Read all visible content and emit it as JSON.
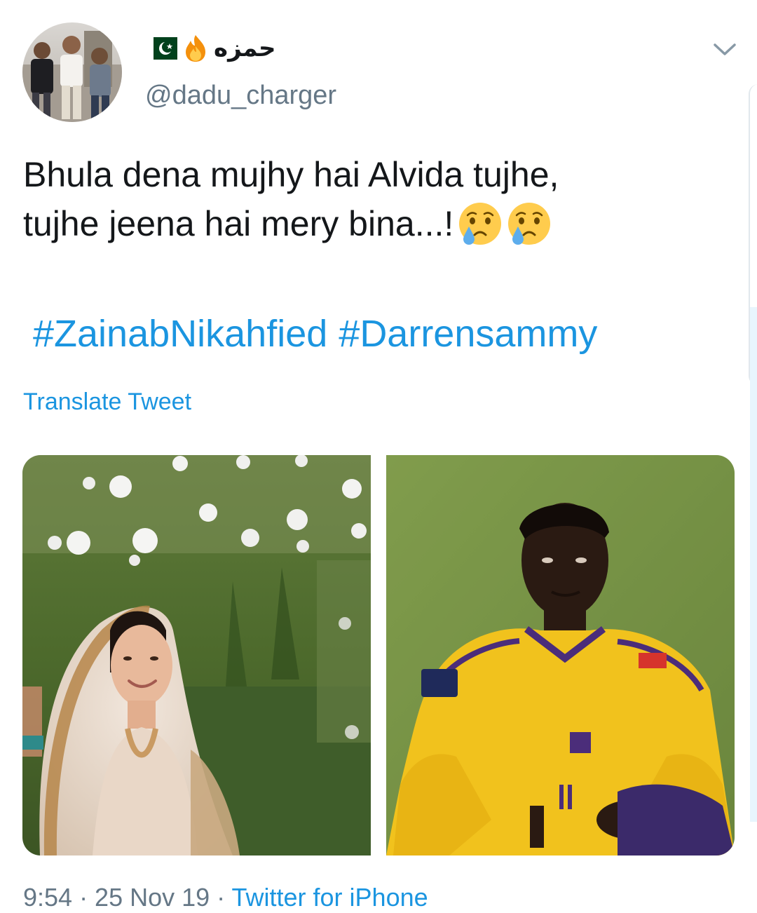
{
  "tweet": {
    "author": {
      "display_name": "حمزه",
      "handle": "@dadu_charger",
      "name_icons": [
        "pakistan-flag-icon",
        "fire-icon"
      ]
    },
    "text_lines": [
      "Bhula dena mujhy hai Alvida tujhe,",
      "tujhe jeena hai mery bina...!"
    ],
    "text_emoji": [
      "crying-face-icon",
      "crying-face-icon"
    ],
    "hashtags": [
      "#ZainabNikahfied",
      "#Darrensammy"
    ],
    "translate_label": "Translate Tweet",
    "media": [
      {
        "name": "bride-photo"
      },
      {
        "name": "cricketer-photo"
      }
    ],
    "meta": {
      "time_date": "9:54 · 25 Nov 19 · ",
      "source": "Twitter for iPhone"
    }
  },
  "colors": {
    "text": "#14171a",
    "secondary": "#657786",
    "link": "#1b95e0"
  }
}
